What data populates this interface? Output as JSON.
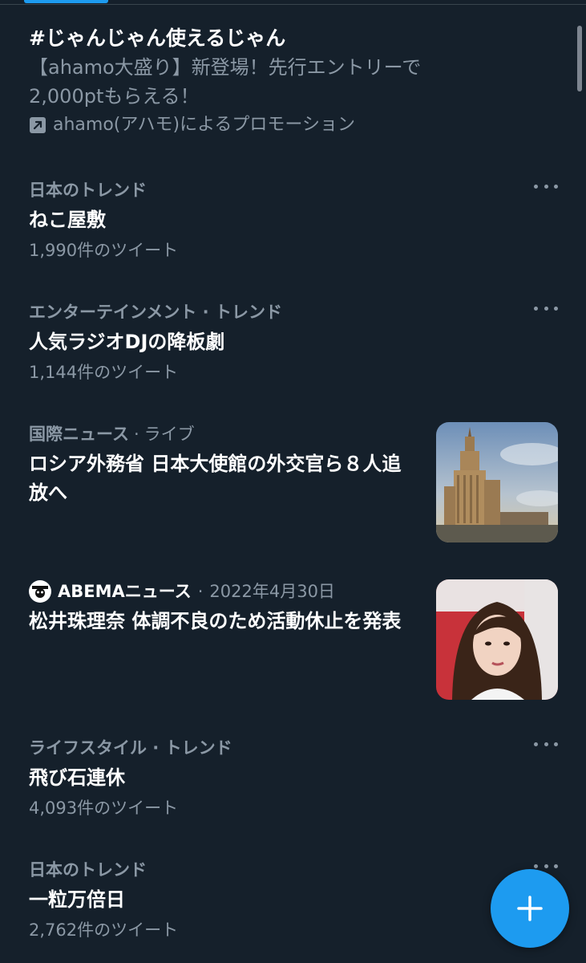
{
  "promo": {
    "hashtag": "#じゃんじゃん使えるじゃん",
    "description": "【ahamo大盛り】新登場！先行エントリーで2,000ptもらえる！",
    "promoted_by": "ahamo(アハモ)によるプロモーション"
  },
  "trends": [
    {
      "category": "日本のトレンド",
      "title": "ねこ屋敷",
      "count": "1,990件のツイート"
    },
    {
      "category": "エンターテインメント · トレンド",
      "title": "人気ラジオDJの降板劇",
      "count": "1,144件のツイート"
    }
  ],
  "news1": {
    "category": "国際ニュース",
    "separator": "·",
    "live": "ライブ",
    "title": "ロシア外務省 日本大使館の外交官ら８人追放へ"
  },
  "news2": {
    "source": "ABEMAニュース",
    "separator": "·",
    "date": "2022年4月30日",
    "title": "松井珠理奈 体調不良のため活動休止を発表"
  },
  "trends2": [
    {
      "category": "ライフスタイル · トレンド",
      "title": "飛び石連休",
      "count": "4,093件のツイート"
    },
    {
      "category": "日本のトレンド",
      "title": "一粒万倍日",
      "count": "2,762件のツイート"
    }
  ],
  "colors": {
    "background": "#15202b",
    "accent": "#1d9bf0",
    "secondary_text": "#8b98a5"
  }
}
